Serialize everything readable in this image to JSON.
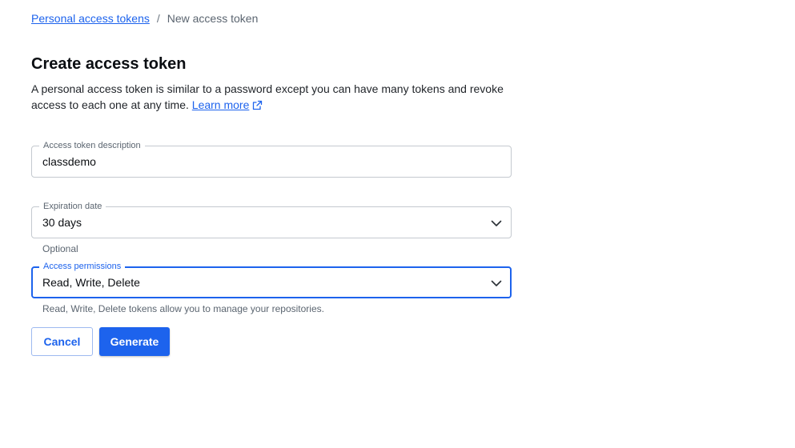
{
  "breadcrumb": {
    "parent_label": "Personal access tokens",
    "separator": "/",
    "current_label": "New access token"
  },
  "page": {
    "title": "Create access token",
    "intro_text": "A personal access token is similar to a password except you can have many tokens and revoke access to each one at any time.",
    "learn_more_label": "Learn more"
  },
  "form": {
    "description": {
      "label": "Access token description",
      "value": "classdemo"
    },
    "expiration": {
      "label": "Expiration date",
      "value": "30 days",
      "helper": "Optional"
    },
    "permissions": {
      "label": "Access permissions",
      "value": "Read, Write, Delete",
      "helper": "Read, Write, Delete tokens allow you to manage your repositories."
    }
  },
  "actions": {
    "cancel_label": "Cancel",
    "generate_label": "Generate"
  },
  "colors": {
    "accent": "#1d63ed",
    "border": "#c4c9cf",
    "muted_text": "#5b6570"
  },
  "icons": {
    "external_link": "external-link-icon",
    "dropdown": "chevron-down-icon"
  }
}
